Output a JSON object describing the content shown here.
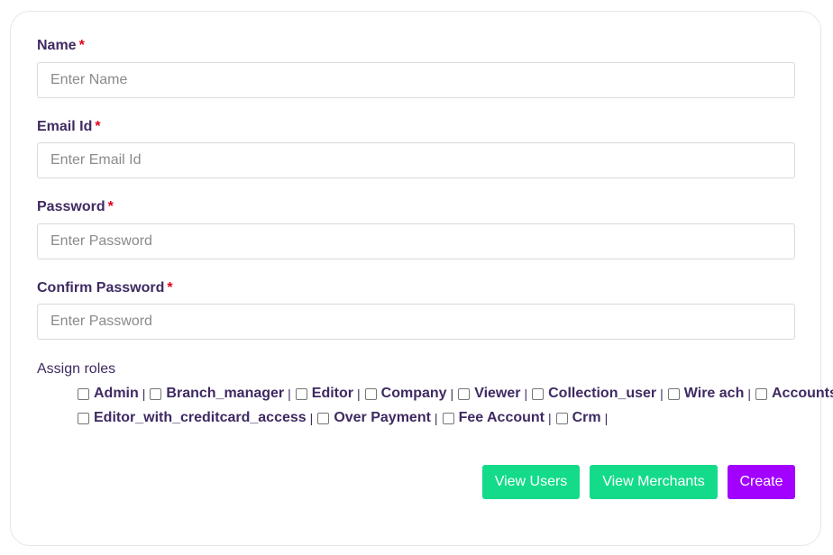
{
  "form": {
    "name": {
      "label": "Name",
      "required_mark": "*",
      "placeholder": "Enter Name",
      "value": ""
    },
    "email": {
      "label": "Email Id",
      "required_mark": "*",
      "placeholder": "Enter Email Id",
      "value": ""
    },
    "password": {
      "label": "Password",
      "required_mark": "*",
      "placeholder": "Enter Password",
      "value": ""
    },
    "confirm_password": {
      "label": "Confirm Password",
      "required_mark": "*",
      "placeholder": "Enter Password",
      "value": ""
    }
  },
  "roles": {
    "label": "Assign roles",
    "separator": "|",
    "items": [
      {
        "label": "Admin",
        "checked": false
      },
      {
        "label": "Branch_manager",
        "checked": false
      },
      {
        "label": "Editor",
        "checked": false
      },
      {
        "label": "Company",
        "checked": false
      },
      {
        "label": "Viewer",
        "checked": false
      },
      {
        "label": "Collection_user",
        "checked": false
      },
      {
        "label": "Wire ach",
        "checked": false
      },
      {
        "label": "Accounts",
        "checked": false
      },
      {
        "label": "Editor_with_creditcard_access",
        "checked": false
      },
      {
        "label": "Over Payment",
        "checked": false
      },
      {
        "label": "Fee Account",
        "checked": false
      },
      {
        "label": "Crm",
        "checked": false
      }
    ]
  },
  "buttons": {
    "view_users": "View Users",
    "view_merchants": "View Merchants",
    "create": "Create"
  },
  "colors": {
    "label_text": "#3f2a62",
    "required": "#e0001b",
    "green_button": "#14db8a",
    "purple_button": "#a200ff"
  }
}
